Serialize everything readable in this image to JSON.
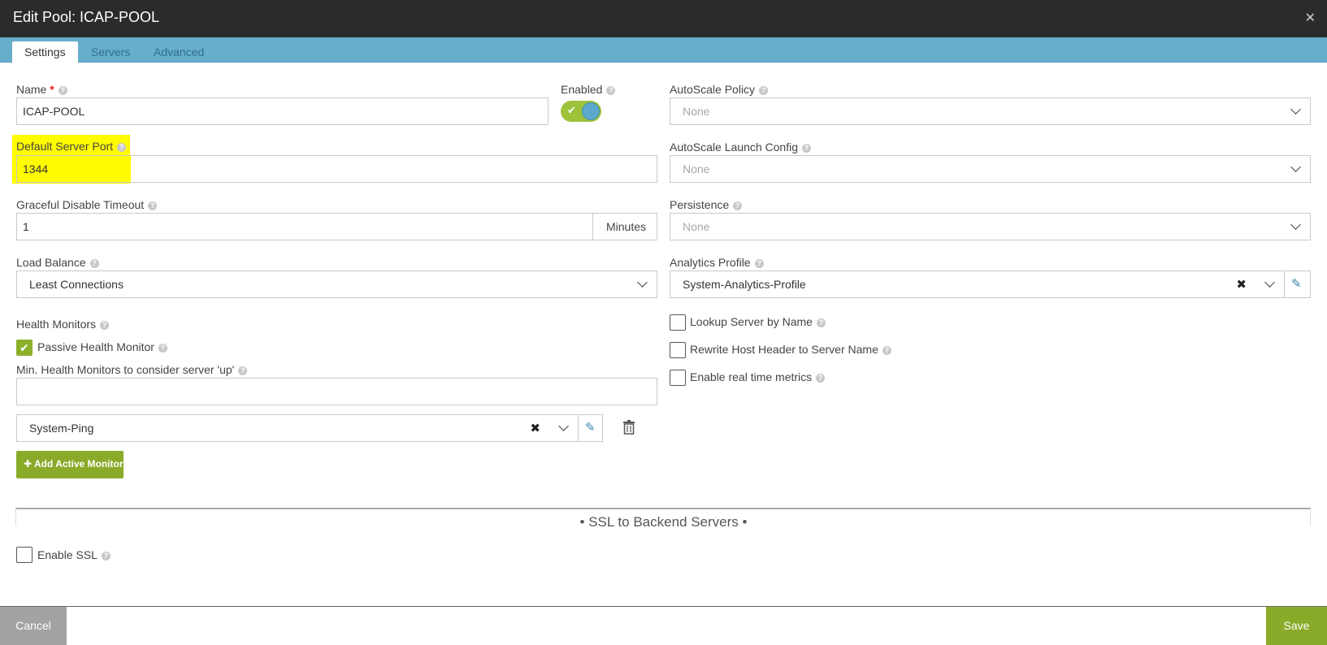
{
  "header": {
    "title": "Edit Pool: ICAP-POOL",
    "close_icon": "close-icon"
  },
  "tabs": [
    "Settings",
    "Servers",
    "Advanced"
  ],
  "form": {
    "name_label": "Name",
    "name_required": "*",
    "name_value": "ICAP-POOL",
    "enabled_label": "Enabled",
    "default_port_label": "Default Server Port",
    "default_port_value": "1344",
    "graceful_label": "Graceful Disable Timeout",
    "graceful_value": "1",
    "graceful_unit": "Minutes",
    "lb_label": "Load Balance",
    "lb_value": "Least Connections",
    "health_label": "Health Monitors",
    "passive_label": "Passive Health Monitor",
    "min_health_label": "Min. Health Monitors to consider server 'up'",
    "min_health_value": "",
    "monitor_value": "System-Ping",
    "add_monitor_label": "Add Active Monitor",
    "autoscale_policy_label": "AutoScale Policy",
    "autoscale_policy_value": "None",
    "autoscale_launch_label": "AutoScale Launch Config",
    "autoscale_launch_value": "None",
    "persistence_label": "Persistence",
    "persistence_value": "None",
    "analytics_label": "Analytics Profile",
    "analytics_value": "System-Analytics-Profile",
    "lookup_label": "Lookup Server by Name",
    "rewrite_label": "Rewrite Host Header to Server Name",
    "realtime_label": "Enable real time metrics",
    "ssl_section_title": "•  SSL to Backend Servers  •",
    "enable_ssl_label": "Enable SSL"
  },
  "footer": {
    "cancel_label": "Cancel",
    "save_label": "Save"
  },
  "colors": {
    "accent": "#8aab2a",
    "tabbar": "#67aecb",
    "titlebar": "#2b2b2b",
    "highlight": "#fffb00"
  }
}
